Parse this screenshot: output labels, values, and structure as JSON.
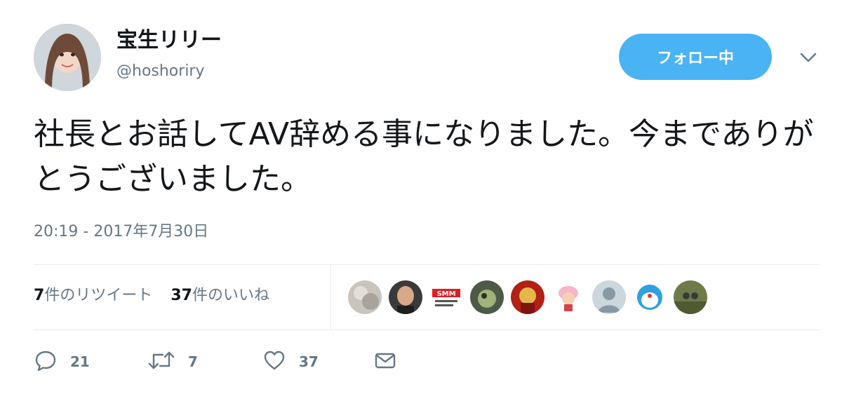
{
  "tweet": {
    "author": {
      "display_name": "宝生リリー",
      "handle": "@hoshoriry"
    },
    "follow_button_label": "フォロー中",
    "text": "社長とお話してAV辞める事になりました。今までありがとうございました。",
    "timestamp": "20:19 - 2017年7月30日",
    "stats": {
      "retweets_count": "7",
      "retweets_label": "件のリツイート",
      "likes_count": "37",
      "likes_label": "件のいいね"
    },
    "liker_avatars": [
      {
        "name": "liker-avatar-1",
        "color": "#c9c4bd"
      },
      {
        "name": "liker-avatar-2",
        "color": "#3a3a3a"
      },
      {
        "name": "liker-avatar-3",
        "color": "#e11d23"
      },
      {
        "name": "liker-avatar-4",
        "color": "#4d5a46"
      },
      {
        "name": "liker-avatar-5",
        "color": "#b32016"
      },
      {
        "name": "liker-avatar-6",
        "color": "#f6b6c8"
      },
      {
        "name": "liker-avatar-7",
        "color": "#ccd6dd"
      },
      {
        "name": "liker-avatar-8",
        "color": "#2fa0e0"
      },
      {
        "name": "liker-avatar-9",
        "color": "#6f7a4a"
      }
    ],
    "actions": {
      "reply_count": "21",
      "retweet_count": "7",
      "like_count": "37"
    }
  },
  "colors": {
    "follow_button_bg": "#4ab3f4",
    "secondary_text": "#657786",
    "primary_text": "#14171a",
    "divider": "#e6ecf0"
  }
}
